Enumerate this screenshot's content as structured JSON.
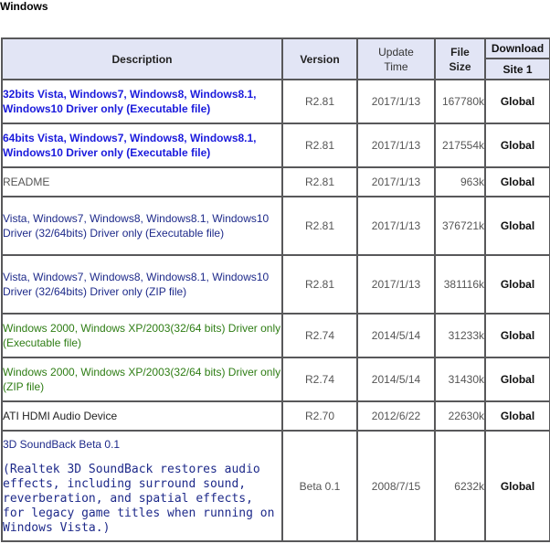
{
  "section_title": "Windows",
  "headers": {
    "description": "Description",
    "version": "Version",
    "update_time_line1": "Update",
    "update_time_line2": "Time",
    "file_size_line1": "File",
    "file_size_line2": "Size",
    "download": "Download",
    "site": "Site 1"
  },
  "rows": [
    {
      "description": "32bits Vista, Windows7, Windows8, Windows8.1, Windows10 Driver only (Executable file)",
      "version": "R2.81",
      "time": "2017/1/13",
      "size": "167780k",
      "site": "Global"
    },
    {
      "description": "64bits Vista, Windows7, Windows8, Windows8.1, Windows10 Driver only (Executable file)",
      "version": "R2.81",
      "time": "2017/1/13",
      "size": "217554k",
      "site": "Global"
    },
    {
      "description": "README",
      "version": "R2.81",
      "time": "2017/1/13",
      "size": "963k",
      "site": "Global"
    },
    {
      "description": "Vista, Windows7, Windows8, Windows8.1, Windows10 Driver (32/64bits) Driver only (Executable file)",
      "version": "R2.81",
      "time": "2017/1/13",
      "size": "376721k",
      "site": "Global"
    },
    {
      "description": "Vista, Windows7, Windows8, Windows8.1, Windows10 Driver (32/64bits) Driver only (ZIP file)",
      "version": "R2.81",
      "time": "2017/1/13",
      "size": "381116k",
      "site": "Global"
    },
    {
      "description": "Windows 2000, Windows XP/2003(32/64 bits) Driver only (Executable file)",
      "version": "R2.74",
      "time": "2014/5/14",
      "size": "31233k",
      "site": "Global"
    },
    {
      "description": "Windows 2000, Windows XP/2003(32/64 bits) Driver only (ZIP file)",
      "version": "R2.74",
      "time": "2014/5/14",
      "size": "31430k",
      "site": "Global"
    },
    {
      "description": "ATI HDMI Audio Device",
      "version": "R2.70",
      "time": "2012/6/22",
      "size": "22630k",
      "site": "Global"
    },
    {
      "description": "3D SoundBack Beta 0.1",
      "description_detail": "(Realtek 3D SoundBack restores audio effects, including surround sound, reverberation, and spatial effects, for legacy game titles when running on Windows Vista.)",
      "version": "Beta 0.1",
      "time": "2008/7/15",
      "size": "6232k",
      "site": "Global"
    }
  ]
}
